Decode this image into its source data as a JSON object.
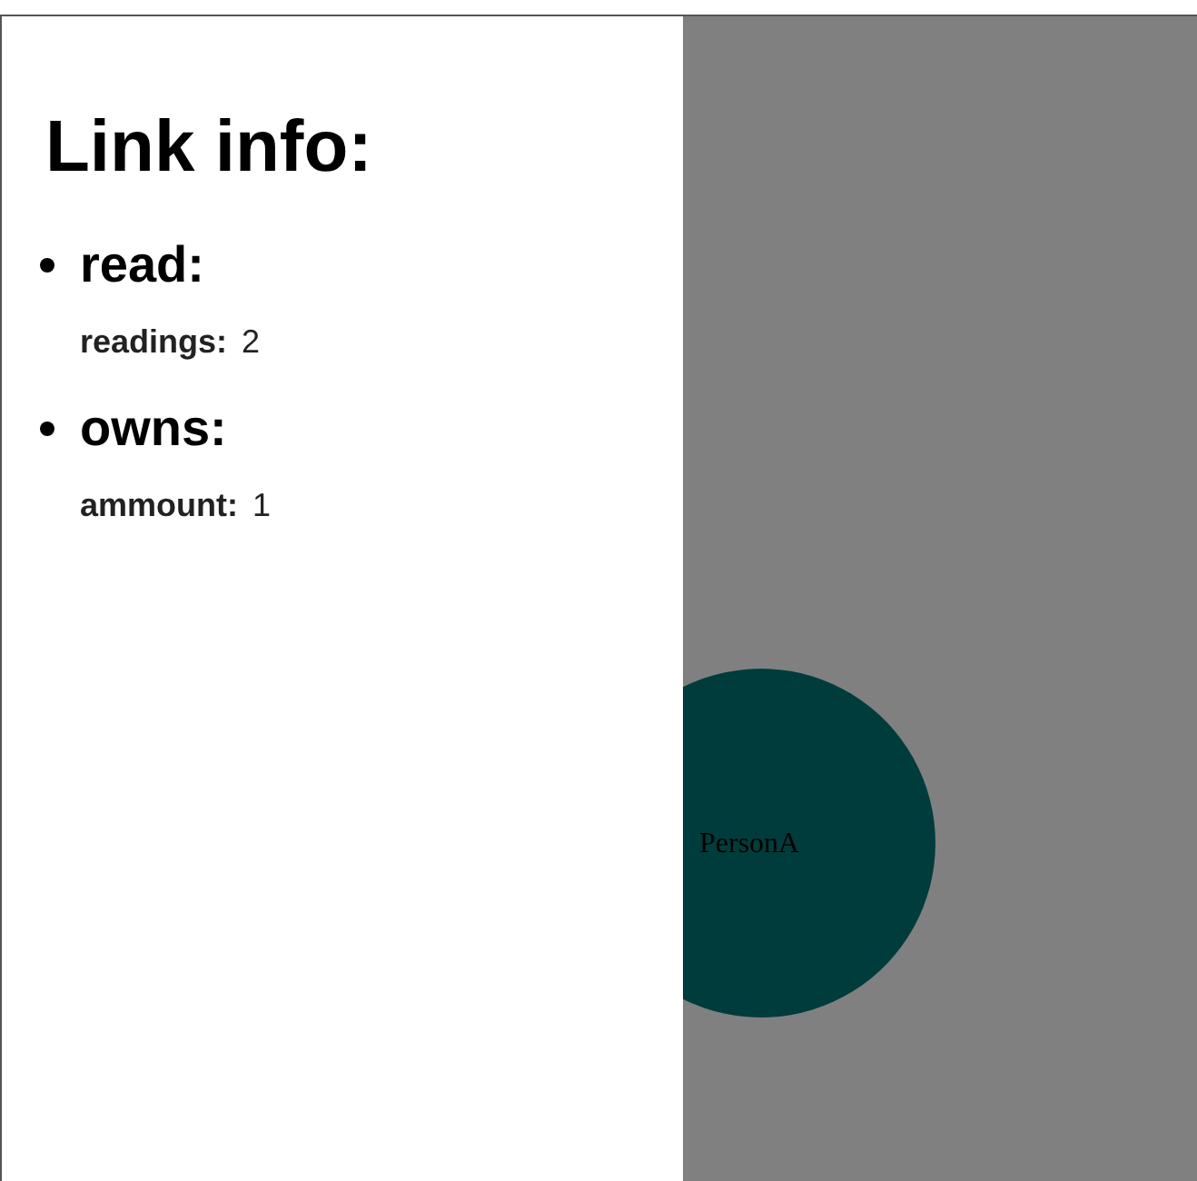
{
  "panel": {
    "title": "Link info:",
    "sections": [
      {
        "title": "read:",
        "fields": [
          {
            "label": "readings:",
            "value": "2"
          }
        ]
      },
      {
        "title": "owns:",
        "fields": [
          {
            "label": "ammount:",
            "value": "1"
          }
        ]
      }
    ]
  },
  "graph": {
    "node": {
      "label": "PersonA"
    }
  }
}
